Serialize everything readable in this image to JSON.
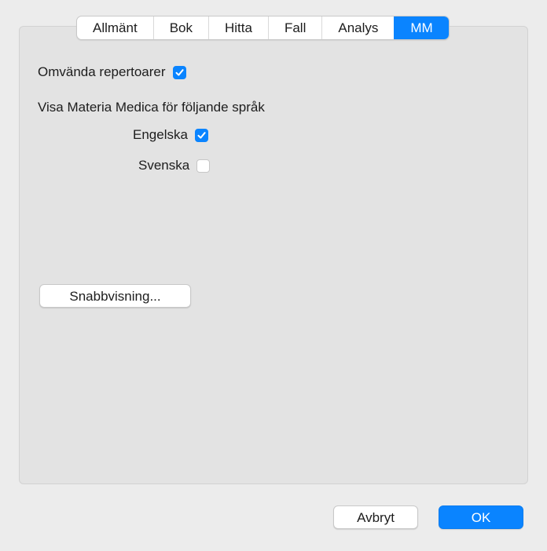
{
  "tabs": [
    {
      "label": "Allmänt",
      "active": false
    },
    {
      "label": "Bok",
      "active": false
    },
    {
      "label": "Hitta",
      "active": false
    },
    {
      "label": "Fall",
      "active": false
    },
    {
      "label": "Analys",
      "active": false
    },
    {
      "label": "MM",
      "active": true
    }
  ],
  "options": {
    "reverse_repertories": {
      "label": "Omvända repertoarer",
      "checked": true
    },
    "languages_heading": "Visa Materia Medica för följande språk",
    "languages": [
      {
        "label": "Engelska",
        "checked": true
      },
      {
        "label": "Svenska",
        "checked": false
      }
    ]
  },
  "buttons": {
    "quick_view": "Snabbvisning...",
    "cancel": "Avbryt",
    "ok": "OK"
  },
  "colors": {
    "accent": "#0a84ff",
    "window_bg": "#ececec",
    "panel_bg": "#e3e3e3"
  }
}
